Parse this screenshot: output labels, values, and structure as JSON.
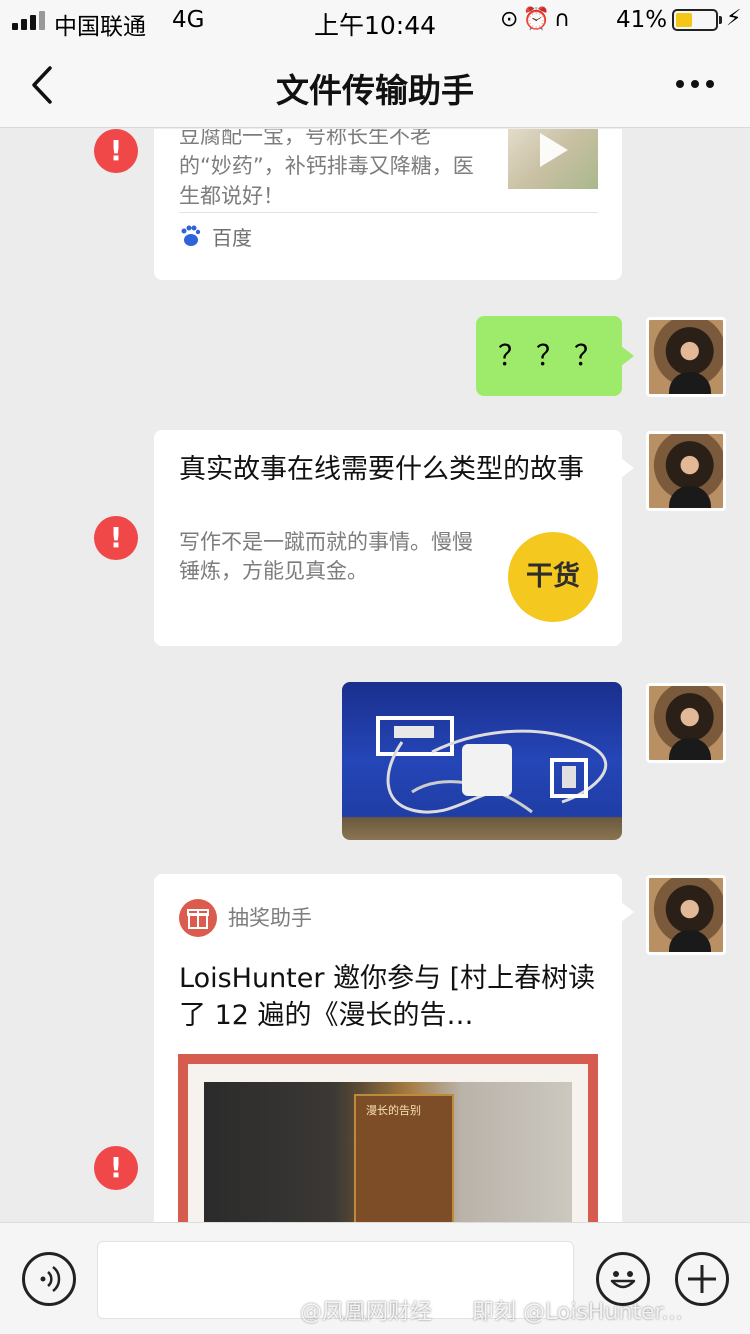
{
  "status_bar": {
    "carrier": "中国联通",
    "network": "4G",
    "time": "上午10:44",
    "battery": "41%",
    "battery_level": 0.41
  },
  "nav": {
    "title": "文件传输助手",
    "back_icon": "chevron-left-icon",
    "more_icon": "more-dots-icon"
  },
  "messages": {
    "card_baidu": {
      "description": "豆腐配一宝，号称长生不老的“妙药”，补钙排毒又降糖，医生都说好！",
      "source": "百度"
    },
    "text_bubble": {
      "text": "？？？"
    },
    "card_story": {
      "title": "真实故事在线需要什么类型的故事",
      "description": "写作不是一蹴而就的事情。慢慢锤炼，方能见真金。",
      "logo_text": "干货"
    },
    "card_lottery": {
      "brand": "抽奖助手",
      "title": "LoisHunter 邀你参与 [村上春树读了 12 遍的《漫长的告…",
      "book_title": "漫长的告别"
    },
    "error_mark": "!"
  },
  "input_bar": {
    "placeholder": "",
    "voice_icon": "voice-icon",
    "emoji_icon": "emoji-icon",
    "plus_icon": "plus-icon"
  },
  "watermark": {
    "left": "@凤凰网财经",
    "right": "即刻 @LoisHunter..."
  },
  "colors": {
    "bubble_green": "#9eea6a",
    "error_red": "#f04848",
    "battery_yellow": "#f5c518",
    "chat_bg": "#ececec"
  }
}
